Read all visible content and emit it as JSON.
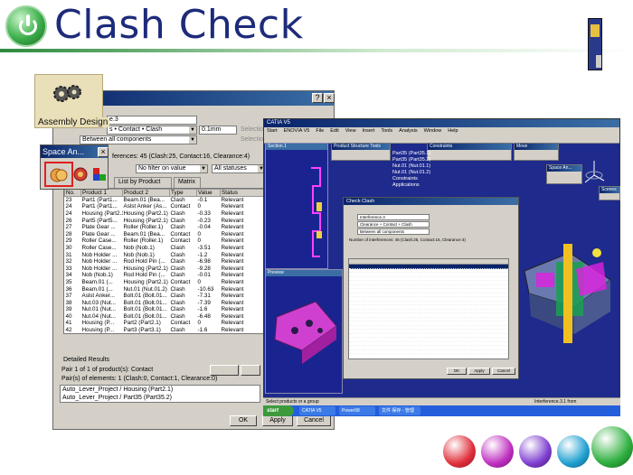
{
  "slide": {
    "title": "Clash Check",
    "assembly_label": "Assembly Design"
  },
  "left_dialog": {
    "name_value": "e.3",
    "type_value": "s • Contact • Clash",
    "clearance_value": "0.1mm",
    "between_value": "Between all components",
    "selection_labels": [
      "Selection",
      "Selection"
    ],
    "summary": "ferences: 45 (Clash:25, Contact:16, Clearance:4)",
    "filter_value": "No filter on value",
    "status_filter": "All statuses",
    "tabs": [
      "List by Product",
      "Matrix"
    ],
    "columns": [
      "No.",
      "Product 1",
      "Product 2",
      "Type",
      "Value",
      "Status"
    ],
    "rows": [
      [
        "23",
        "Part1 (Part1...",
        "Beam.01 (Bea...",
        "Clash",
        "-0.1",
        "Relevant"
      ],
      [
        "24",
        "Part1 (Part1...",
        "Aslst Anker (As...",
        "Contact",
        "0",
        "Relevant"
      ],
      [
        "24",
        "Housing (Part2.1)",
        "Housing (Part2.1)",
        "Clash",
        "-0.33",
        "Relevant"
      ],
      [
        "26",
        "Part5 (Part5...",
        "Housing (Part2.1)",
        "Clash",
        "-0.23",
        "Relevant"
      ],
      [
        "27",
        "Plate Gear ...",
        "Roller (Roller.1)",
        "Clash",
        "-0.04",
        "Relevant"
      ],
      [
        "28",
        "Plate Gear ...",
        "Beam.01 (Bea...",
        "Contact",
        "0",
        "Relevant"
      ],
      [
        "29",
        "Roller Case...",
        "Roller (Roller.1)",
        "Contact",
        "0",
        "Relevant"
      ],
      [
        "30",
        "Roller Case...",
        "Nob (Nob.1)",
        "Clash",
        "-3.51",
        "Relevant"
      ],
      [
        "31",
        "Nob Holder ...",
        "Nob (Nob.1)",
        "Clash",
        "-1.2",
        "Relevant"
      ],
      [
        "32",
        "Nob Holder ...",
        "Rod Hold Pin (...",
        "Clash",
        "-6.98",
        "Relevant"
      ],
      [
        "33",
        "Nob Holder ...",
        "Housing (Part2.1)",
        "Clash",
        "-9.28",
        "Relevant"
      ],
      [
        "34",
        "Nob (Nob.1)",
        "Rod Hold Pin (...",
        "Clash",
        "-0.01",
        "Relevant"
      ],
      [
        "35",
        "Beam.01 (...",
        "Housing (Part2.1)",
        "Contact",
        "0",
        "Relevant"
      ],
      [
        "36",
        "Beam.01 (...",
        "Nut.01 (Nut.01.2)",
        "Clash",
        "-10.63",
        "Relevant"
      ],
      [
        "37",
        "Aslst Anker...",
        "Bolt.01 (Bolt.01...",
        "Clash",
        "-7.31",
        "Relevant"
      ],
      [
        "38",
        "Nut.03 (Nut...",
        "Bolt.01 (Bolt.01...",
        "Clash",
        "-7.39",
        "Relevant"
      ],
      [
        "39",
        "Nut.01 (Nut...",
        "Bolt.01 (Bolt.01...",
        "Clash",
        "-1.6",
        "Relevant"
      ],
      [
        "40",
        "Nut.04 (Nut...",
        "Bolt.01 (Bolt.01...",
        "Clash",
        "-6.48",
        "Relevant"
      ],
      [
        "41",
        "Housing (P...",
        "Part2 (Part2.1)",
        "Contact",
        "0",
        "Relevant"
      ],
      [
        "42",
        "Housing (P...",
        "Part3 (Part3.1)",
        "Clash",
        "-1.6",
        "Relevant"
      ],
      [
        "43",
        "Housing (P...",
        "Part35 (Part35.1)",
        "Contact",
        "0",
        "Relevant"
      ],
      [
        "44",
        "Housing (P...",
        "Part35 (Part35.2)",
        "Contact",
        "0",
        "Relevant"
      ],
      [
        "45",
        "Bolt.01 (Bol...",
        "Nut.01 (Nut.01.1)",
        "Clash",
        "-4.48",
        "Relevant"
      ]
    ],
    "selected_index": 21,
    "detailed_results_label": "Detailed Results",
    "pair_text": "Pair 1 of 1 of product(s): Contact",
    "pairs_of_elements": "Pair(s) of elements: 1 (Clash:0, Contact:1, Clearance:0)",
    "results_lines": [
      "Auto_Lever_Project / Housing (Part2.1)",
      "Auto_Lever_Project / Part35 (Part35.2)"
    ],
    "btn_ok": "OK",
    "btn_apply": "Apply",
    "btn_cancel": "Cancel"
  },
  "space_panel": {
    "title": "Space An..."
  },
  "catia": {
    "title": "CATIA V5",
    "menus": [
      "Start",
      "ENOVIA V5",
      "File",
      "Edit",
      "View",
      "Insert",
      "Tools",
      "Analysis",
      "Window",
      "Help"
    ],
    "section_label": "Section.1",
    "preview_label": "Preview",
    "pst_label": "Product Structure Tools",
    "constraints_label": "Constraints",
    "move_label": "Move",
    "space_label": "Space An...",
    "scenes_label": "Scenes",
    "tree_items": [
      "Part35 (Part35.1)",
      "Part35 (Part35.2)",
      "Nut.01 (Nut.01.1)",
      "Nut.01 (Nut.01.2)",
      "Constraints",
      "Applications"
    ],
    "check_title": "Check Clash",
    "check_fields": [
      "Interference.3",
      "Clearance + Contact + Clash",
      "Between all components"
    ],
    "check_summary": "Number of interferences: 45 (Clash:25, Contact:16, Clearance:4)",
    "status_text": "Select products or a group",
    "status_right": "Interference.3.1 from",
    "taskbar_items": [
      "CATIA V5",
      "Power98",
      "文件 保存 - 管理"
    ]
  },
  "colors": {
    "title": "#1d2b7a",
    "logo_green": "#3cae4a",
    "selection": "#0a246a",
    "catia_bg": "#1e2a8c",
    "circle_red": "#e0303c",
    "circle_magenta": "#c030c0",
    "circle_purple": "#8040d0",
    "circle_cyan": "#20a0d0",
    "circle_green": "#30b040"
  }
}
